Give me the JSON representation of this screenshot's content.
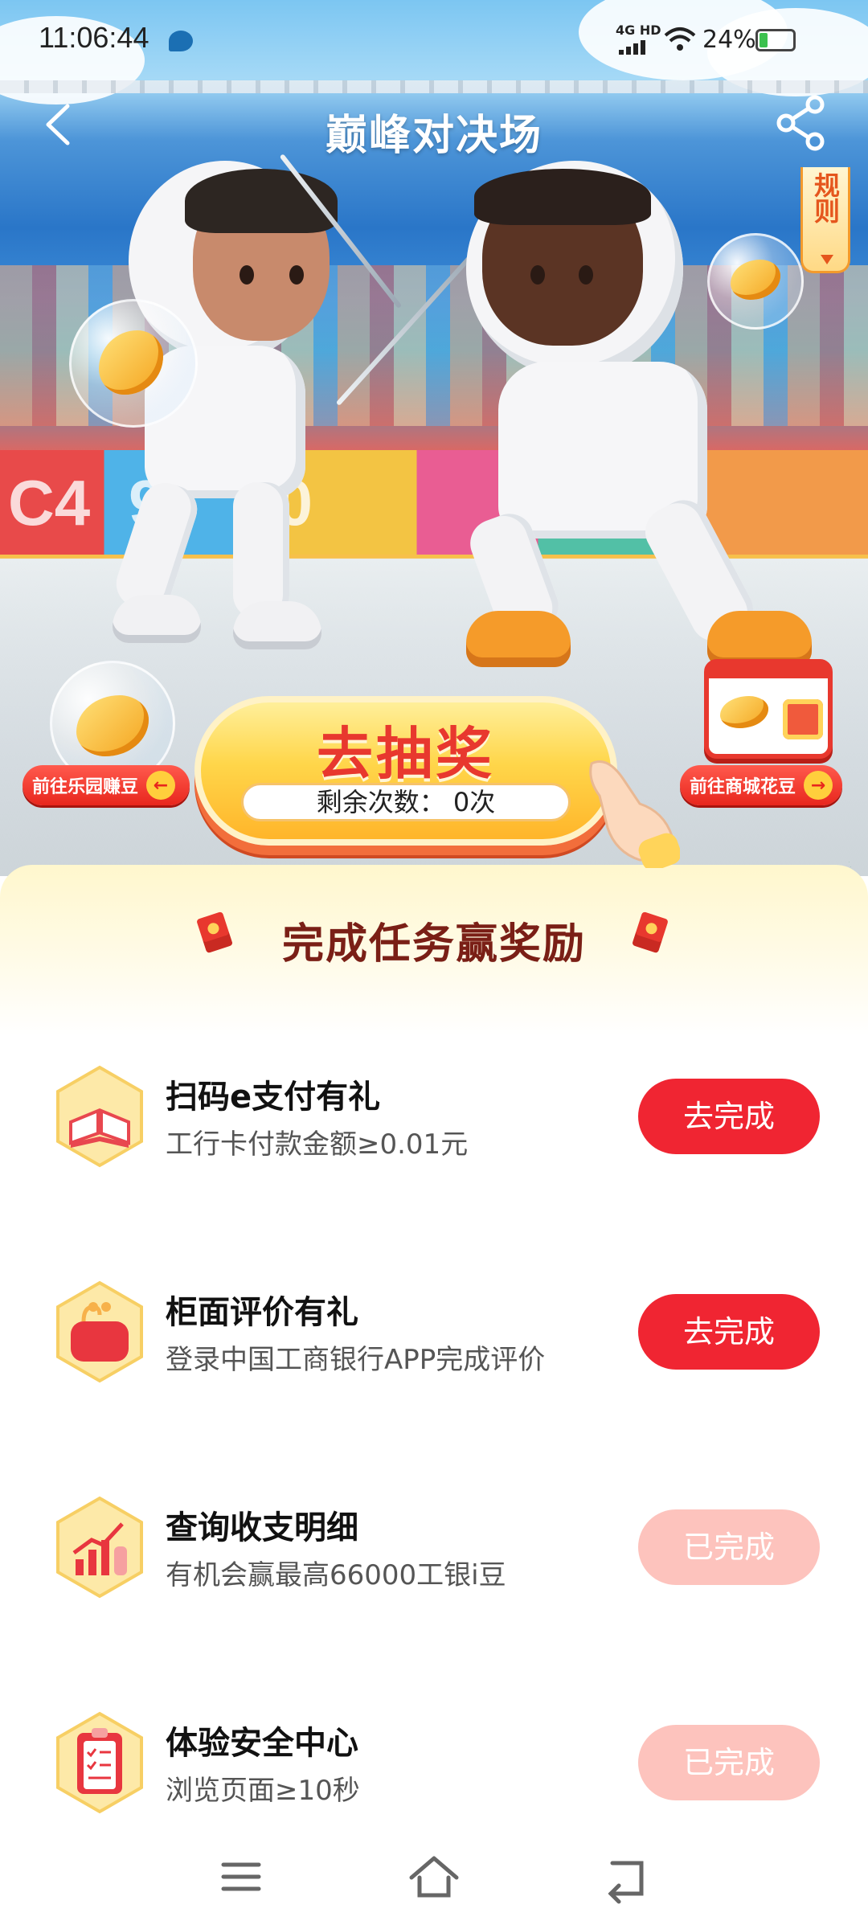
{
  "status_bar": {
    "time": "11:06:44",
    "network": "4G HD",
    "battery": "24%",
    "icons": [
      "message-icon",
      "signal-icon",
      "wifi-icon",
      "battery-icon"
    ]
  },
  "header": {
    "title": "巅峰对决场",
    "back_icon": "back-arrow-icon",
    "share_icon": "share-icon"
  },
  "hero": {
    "rules_label": "规则",
    "left_chip": "前往乐园赚豆",
    "right_chip": "前往商城花豆",
    "draw": {
      "label": "去抽奖",
      "remaining_label": "剩余次数：",
      "remaining_value": "0次"
    }
  },
  "tasks_section": {
    "title": "完成任务赢奖励",
    "tasks": [
      {
        "title": "扫码e支付有礼",
        "desc": "工行卡付款金额≥0.01元",
        "button": "去完成",
        "state": "todo",
        "icon": "book-icon"
      },
      {
        "title": "柜面评价有礼",
        "desc": "登录中国工商银行APP完成评价",
        "button": "去完成",
        "state": "todo",
        "icon": "wallet-icon"
      },
      {
        "title": "查询收支明细",
        "desc": "有机会赢最高66000工银i豆",
        "button": "已完成",
        "state": "done",
        "icon": "chart-icon"
      },
      {
        "title": "体验安全中心",
        "desc": "浏览页面≥10秒",
        "button": "已完成",
        "state": "done",
        "icon": "clipboard-icon"
      }
    ]
  },
  "nav": {
    "items": [
      "menu-icon",
      "home-icon",
      "back-icon"
    ]
  },
  "colors": {
    "accent_red": "#f02532",
    "done_pink": "#fdc3bd",
    "title_brown": "#7a1f16"
  }
}
